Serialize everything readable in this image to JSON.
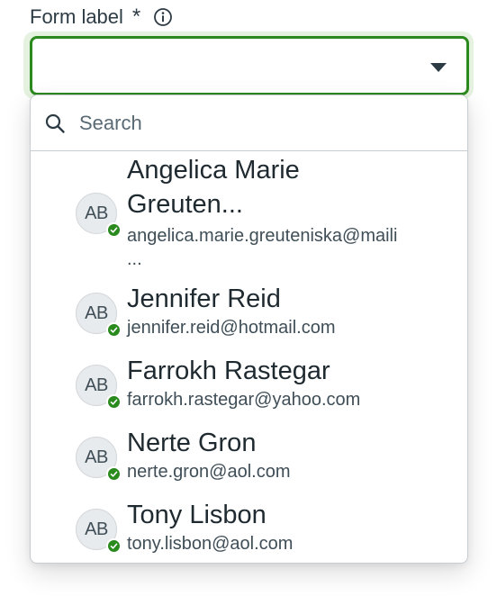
{
  "form": {
    "label": "Form label",
    "required_mark": "*",
    "info_icon": "info-circle-icon",
    "select_value": "",
    "accent_color": "#2b8a1e"
  },
  "search": {
    "placeholder": "Search",
    "value": "",
    "icon": "search-icon"
  },
  "options": [
    {
      "initials": "AB",
      "name_line1": "Angelica Marie",
      "name_line2": "Greuten...",
      "email_line1": "angelica.marie.greuteniska@maili",
      "email_line2": "...",
      "status": "online"
    },
    {
      "initials": "AB",
      "name": "Jennifer Reid",
      "email": "jennifer.reid@hotmail.com",
      "status": "online"
    },
    {
      "initials": "AB",
      "name": "Farrokh Rastegar",
      "email": "farrokh.rastegar@yahoo.com",
      "status": "online"
    },
    {
      "initials": "AB",
      "name": "Nerte Gron",
      "email": "nerte.gron@aol.com",
      "status": "online"
    },
    {
      "initials": "AB",
      "name": "Tony Lisbon",
      "email": "tony.lisbon@aol.com",
      "status": "online"
    }
  ]
}
